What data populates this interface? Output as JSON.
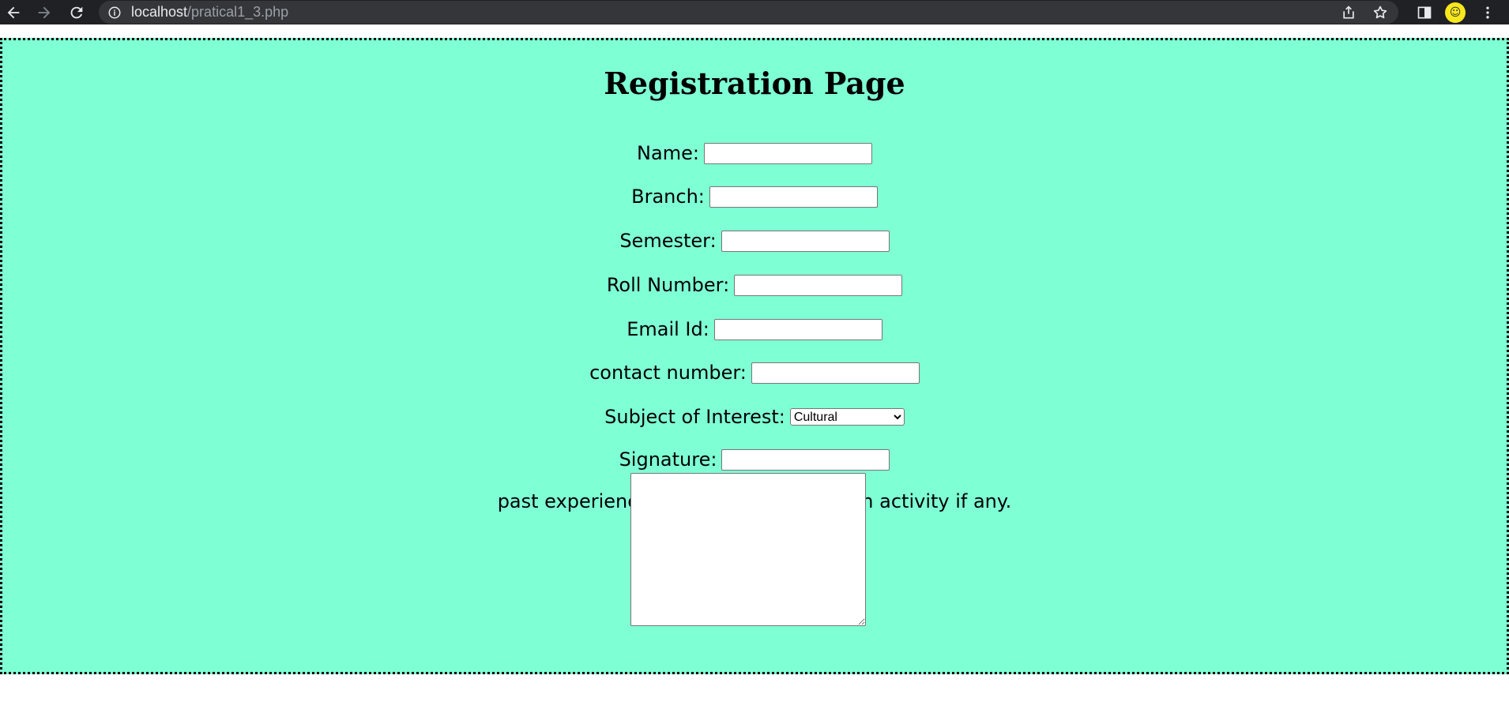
{
  "browser": {
    "url_host": "localhost",
    "url_path": "/pratical1_3.php"
  },
  "form": {
    "title": "Registration Page",
    "fields": {
      "name": {
        "label": "Name:",
        "value": ""
      },
      "branch": {
        "label": "Branch:",
        "value": ""
      },
      "semester": {
        "label": "Semester:",
        "value": ""
      },
      "roll_number": {
        "label": "Roll Number:",
        "value": ""
      },
      "email": {
        "label": "Email Id:",
        "value": ""
      },
      "contact": {
        "label": "contact number:",
        "value": ""
      },
      "subject": {
        "label": "Subject of Interest:",
        "selected": "Cultural"
      },
      "signature": {
        "label": "Signature:",
        "value": ""
      }
    },
    "experience_label": "past experience of participation in such activity if any.",
    "experience_value": ""
  },
  "colors": {
    "form_background": "#7fffd4",
    "chrome_background": "#202124"
  }
}
